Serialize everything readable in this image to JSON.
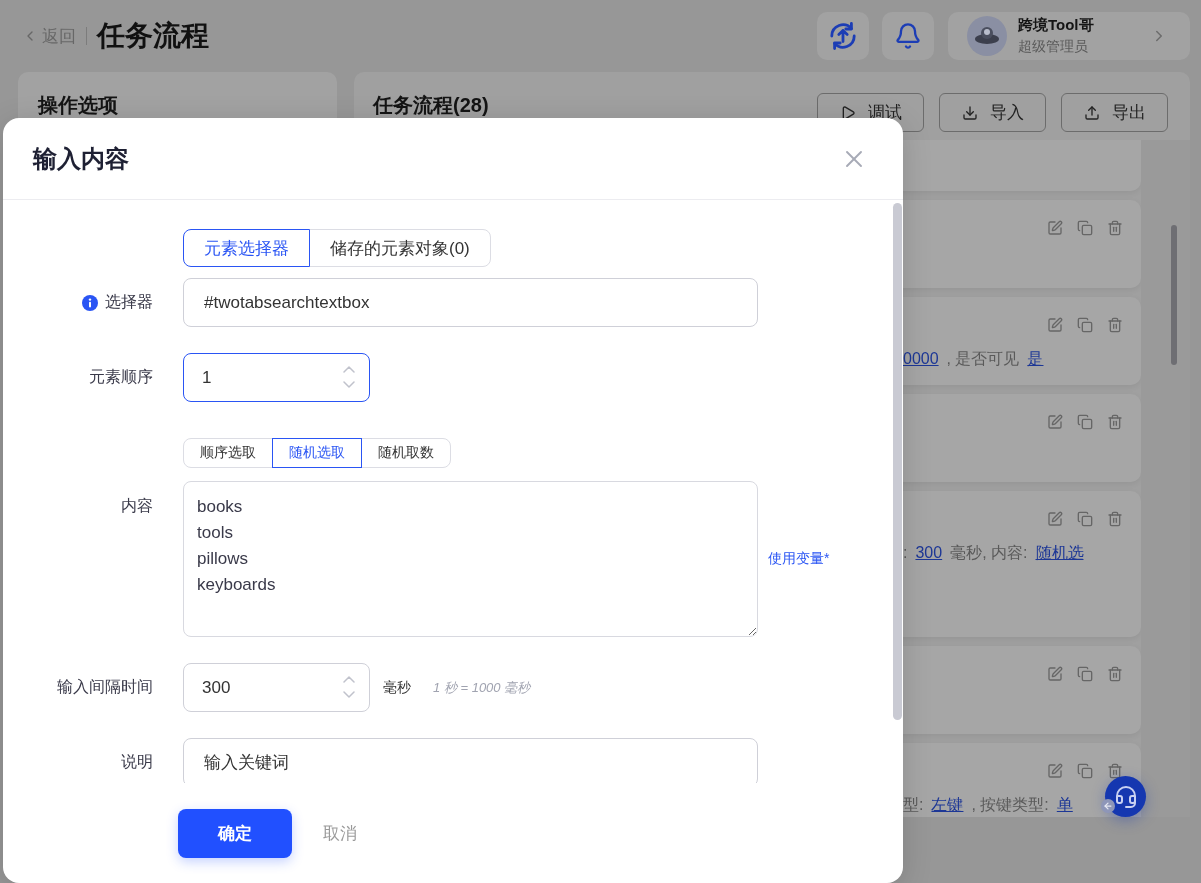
{
  "header": {
    "back": "返回",
    "title": "任务流程",
    "user": {
      "name": "跨境Tool哥",
      "role": "超级管理员"
    }
  },
  "options_panel": {
    "title": "操作选项"
  },
  "flow_panel": {
    "title": "任务流程(28)",
    "buttons": [
      "调试",
      "导入",
      "导出"
    ],
    "cards": [
      {
        "kind": "step"
      },
      {
        "kind": "step",
        "detail": [
          {
            "text": "0000",
            "link": true
          },
          {
            "text": ", 是否可见",
            "link": false
          },
          {
            "text": "是",
            "link": true
          }
        ]
      },
      {
        "kind": "step"
      },
      {
        "kind": "input",
        "detail": [
          {
            "text": ":",
            "link": false
          },
          {
            "text": "300",
            "link": true
          },
          {
            "text": "毫秒, 内容:",
            "link": false
          },
          {
            "text": "随机选",
            "link": true
          }
        ]
      },
      {
        "kind": "step"
      },
      {
        "kind": "step",
        "detail": [
          {
            "text": "型:",
            "link": false
          },
          {
            "text": "左键",
            "link": true
          },
          {
            "text": ", 按键类型:",
            "link": false
          },
          {
            "text": "单",
            "link": true
          }
        ]
      }
    ]
  },
  "dialog": {
    "title": "输入内容",
    "source_tabs": [
      {
        "label": "元素选择器",
        "selected": true
      },
      {
        "label": "储存的元素对象(0)",
        "selected": false
      }
    ],
    "selector": {
      "label": "选择器",
      "value": "#twotabsearchtextbox"
    },
    "order": {
      "label": "元素顺序",
      "value": "1",
      "focused": true
    },
    "mode_tabs": [
      {
        "label": "顺序选取",
        "selected": false
      },
      {
        "label": "随机选取",
        "selected": true
      },
      {
        "label": "随机取数",
        "selected": false
      }
    ],
    "content": {
      "label": "内容",
      "value": "books\ntools\npillows\nkeyboards",
      "variable_link": "使用变量*"
    },
    "interval": {
      "label": "输入间隔时间",
      "value": "300",
      "focused": false,
      "unit": "毫秒",
      "hint": "1 秒 = 1000 毫秒"
    },
    "note": {
      "label": "说明",
      "value": "输入关键词"
    },
    "buttons": {
      "confirm": "确定",
      "cancel": "取消"
    }
  }
}
